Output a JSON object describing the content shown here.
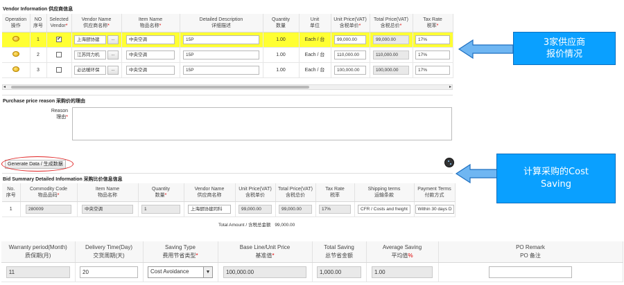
{
  "vendor_section": {
    "title": "Vendor Information 供应商信息",
    "headers": [
      {
        "en": "Operation",
        "cn": "操作",
        "req": false
      },
      {
        "en": "NO",
        "cn": "序号",
        "req": false
      },
      {
        "en": "Selected",
        "cn": "Vendor",
        "req": true
      },
      {
        "en": "Vendor Name",
        "cn": "供应商名称",
        "req": true
      },
      {
        "en": "Item Name",
        "cn": "物品名称",
        "req": true
      },
      {
        "en": "Detailed Description",
        "cn": "详细描述",
        "req": false
      },
      {
        "en": "Quantity",
        "cn": "数量",
        "req": false
      },
      {
        "en": "Unit",
        "cn": "单位",
        "req": false
      },
      {
        "en": "Unit Price(VAT)",
        "cn": "含税单价",
        "req": true
      },
      {
        "en": "Total Price(VAT)",
        "cn": "含税总价",
        "req": true
      },
      {
        "en": "Tax Rate",
        "cn": "税率",
        "req": true
      }
    ],
    "rows": [
      {
        "no": "1",
        "selected": true,
        "vendor": "上海厨协建",
        "item": "中央空调",
        "desc": "15P",
        "qty": "1.00",
        "unit": "Each / 台",
        "unit_price": "99,000.00",
        "total": "99,000.00",
        "tax": "17%"
      },
      {
        "no": "2",
        "selected": false,
        "vendor": "江苏同力机",
        "item": "中央空调",
        "desc": "15P",
        "qty": "1.00",
        "unit": "Each / 台",
        "unit_price": "110,000.00",
        "total": "110,000.00",
        "tax": "17%"
      },
      {
        "no": "3",
        "selected": false,
        "vendor": "必达暖环保",
        "item": "中央空调",
        "desc": "15P",
        "qty": "1.00",
        "unit": "Each / 台",
        "unit_price": "100,000.00",
        "total": "100,000.00",
        "tax": "17%"
      }
    ]
  },
  "reason_section": {
    "title": "Purchase price reason 采购价的理由",
    "label_en": "Reason",
    "label_cn": "理由"
  },
  "generate_button": "Generate Data / 生成数据",
  "summary_section": {
    "title": "Bid Summary Detailed Information 采购比价信息信息",
    "headers": [
      {
        "en": "No.",
        "cn": "序号",
        "req": false
      },
      {
        "en": "Commodity Code",
        "cn": "物品品码",
        "req": true
      },
      {
        "en": "Item Name",
        "cn": "物品名称",
        "req": false
      },
      {
        "en": "Quantity",
        "cn": "数量",
        "req": true
      },
      {
        "en": "Vendor Name",
        "cn": "供应商名称",
        "req": false
      },
      {
        "en": "Unit Price(VAT)",
        "cn": "含税单价",
        "req": false
      },
      {
        "en": "Total Price(VAT)",
        "cn": "含税总价",
        "req": false
      },
      {
        "en": "Tax Rate",
        "cn": "税率",
        "req": false
      },
      {
        "en": "Shipping terms",
        "cn": "运输条款",
        "req": false
      },
      {
        "en": "Payment Terms",
        "cn": "付款方式",
        "req": false
      }
    ],
    "row": {
      "no": "1",
      "code": "280009",
      "item": "中央空调",
      "qty": "1",
      "vendor": "上海厨协建同科",
      "unit_price": "99,000.00",
      "total": "99,000.00",
      "tax": "17%",
      "shipping": "CFR / Costs and freight",
      "payment": "Within 30 days D"
    },
    "total_label": "Total Amount / 含税总金额",
    "total_value": "99,000.00"
  },
  "bottom_section": {
    "headers": [
      {
        "en": "Warranty period(Month)",
        "cn": "质保期(月)",
        "req": false,
        "pct": false
      },
      {
        "en": "Delivery Time(Day)",
        "cn": "交货周期(天)",
        "req": false,
        "pct": false
      },
      {
        "en": "Saving Type",
        "cn": "费用节省类型",
        "req": true,
        "pct": false
      },
      {
        "en": "Base Line/Unit Price",
        "cn": "基准值",
        "req": true,
        "pct": false
      },
      {
        "en": "Total Saving",
        "cn": "总节省金额",
        "req": false,
        "pct": false
      },
      {
        "en": "Average Saving",
        "cn": "平均值",
        "req": false,
        "pct": true
      },
      {
        "en": "PO Remark",
        "cn": "PO 备注",
        "req": false,
        "pct": false
      }
    ],
    "values": {
      "warranty": "11",
      "delivery": "20",
      "saving_type": "Cost Avoidance",
      "baseline": "100,000.00",
      "total_saving": "1,000.00",
      "avg_saving": "1.00",
      "po_remark": ""
    }
  },
  "callouts": {
    "vendor_quote": "3家供应商\n报价情况",
    "cost_saving": "计算采购的Cost\nSaving"
  },
  "colors": {
    "highlight": "#ffff33",
    "callout": "#0aa0ff",
    "arrow": "#1e88e5",
    "ellipse": "#e02020"
  }
}
